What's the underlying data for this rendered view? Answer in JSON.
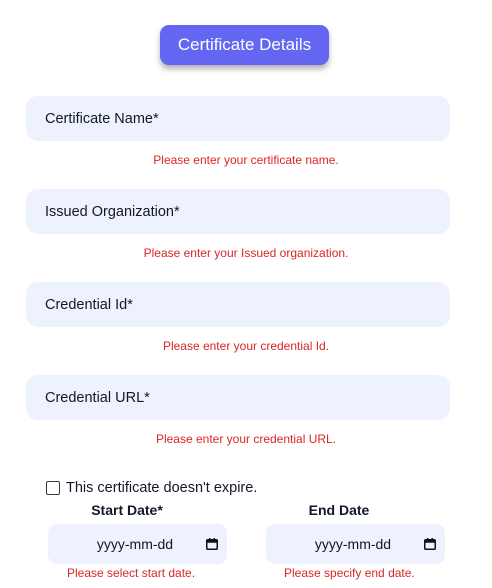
{
  "header": {
    "title": "Certificate Details"
  },
  "fields": [
    {
      "label": "Certificate Name*",
      "error": "Please enter your certificate name."
    },
    {
      "label": "Issued Organization*",
      "error": "Please enter your Issued organization."
    },
    {
      "label": "Credential Id*",
      "error": "Please enter your credential Id."
    },
    {
      "label": "Credential URL*",
      "error": "Please enter your credential URL."
    }
  ],
  "no_expiry": {
    "label": "This certificate doesn't expire.",
    "checked": false
  },
  "start_date": {
    "label": "Start Date*",
    "placeholder": "yyyy-mm-dd",
    "error": "Please select start date."
  },
  "end_date": {
    "label": "End Date",
    "placeholder": "yyyy-mm-dd",
    "error": "Please specify end date."
  },
  "icons": {
    "calendar": "calendar-icon"
  }
}
